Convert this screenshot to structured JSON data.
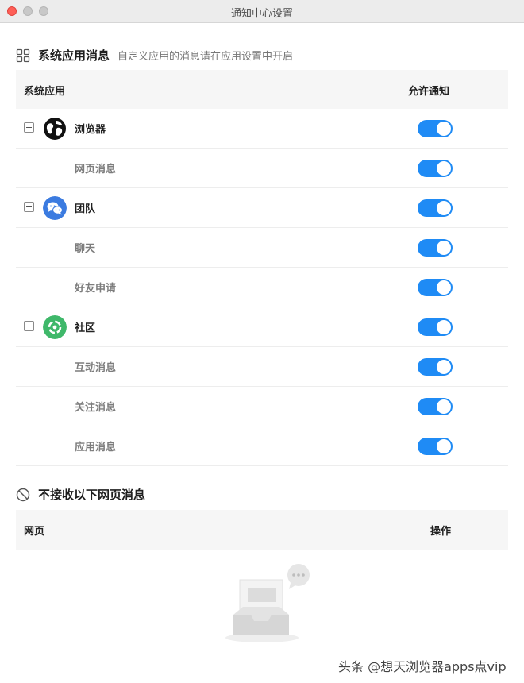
{
  "window": {
    "title": "通知中心设置"
  },
  "system_apps_section": {
    "title": "系统应用消息",
    "description": "自定义应用的消息请在应用设置中开启",
    "table": {
      "col_app": "系统应用",
      "col_allow": "允许通知"
    },
    "rows": [
      {
        "kind": "app",
        "icon": "globe-icon",
        "label": "浏览器",
        "enabled": true
      },
      {
        "kind": "sub",
        "label": "网页消息",
        "enabled": true
      },
      {
        "kind": "app",
        "icon": "chat-bubbles-icon",
        "label": "团队",
        "enabled": true
      },
      {
        "kind": "sub",
        "label": "聊天",
        "enabled": true
      },
      {
        "kind": "sub",
        "label": "好友申请",
        "enabled": true
      },
      {
        "kind": "app",
        "icon": "community-icon",
        "label": "社区",
        "enabled": true
      },
      {
        "kind": "sub",
        "label": "互动消息",
        "enabled": true
      },
      {
        "kind": "sub",
        "label": "关注消息",
        "enabled": true
      },
      {
        "kind": "sub",
        "label": "应用消息",
        "enabled": true
      }
    ]
  },
  "blocked_section": {
    "title": "不接收以下网页消息",
    "table": {
      "col_page": "网页",
      "col_action": "操作"
    },
    "empty_state_icon": "empty-inbox-icon"
  },
  "watermark": "头条 @想天浏览器apps点vip",
  "colors": {
    "toggle_on": "#1f8bf5",
    "globe_icon": "#111111",
    "team_icon": "#3b7be0",
    "community_icon": "#3fb86a"
  }
}
